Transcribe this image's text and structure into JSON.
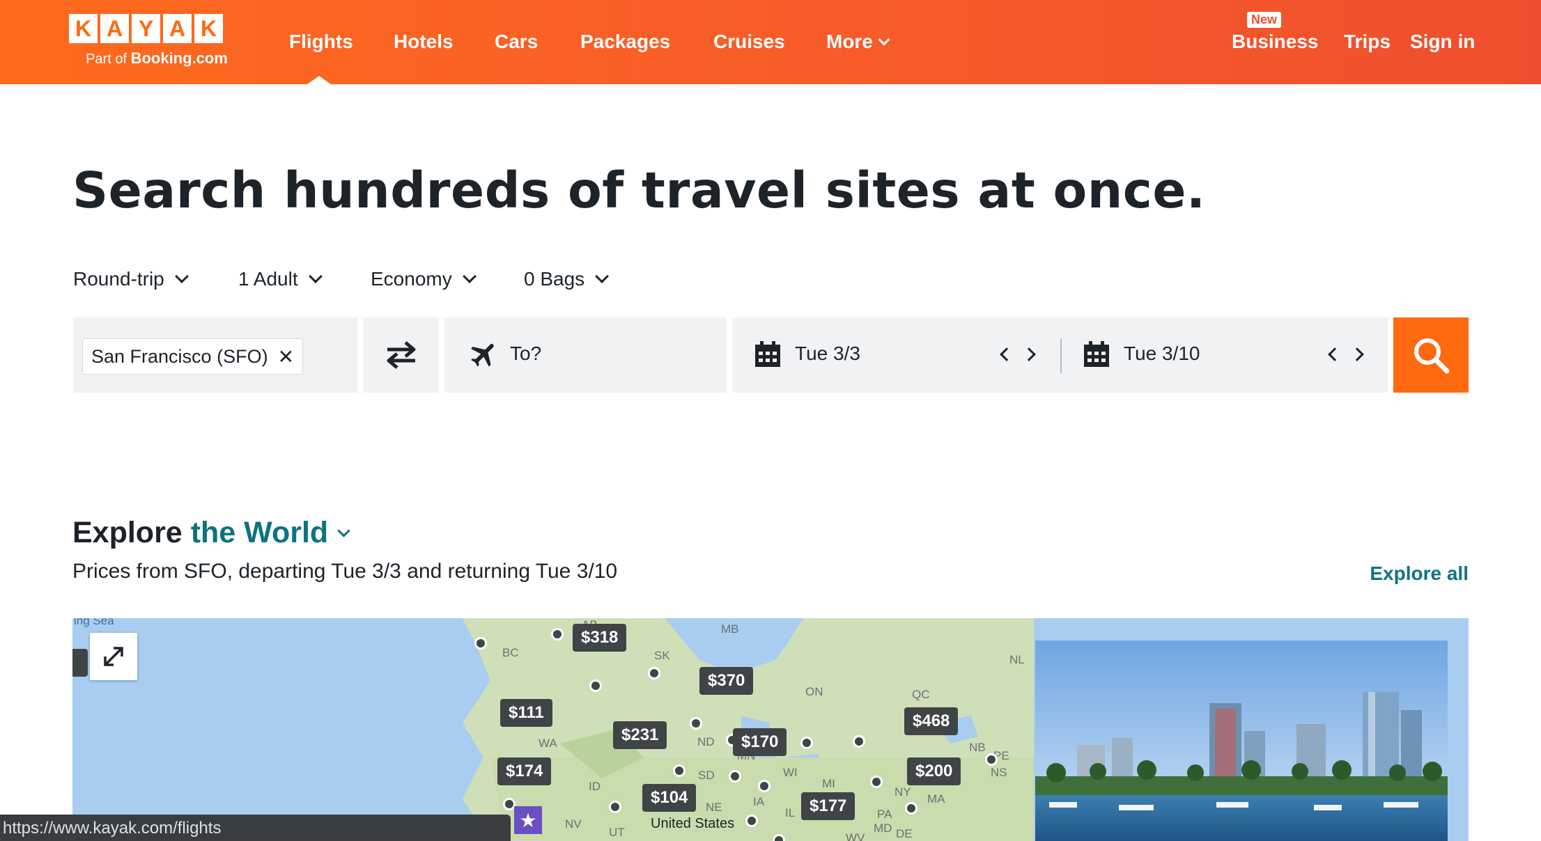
{
  "logo": {
    "letters": [
      "K",
      "A",
      "Y",
      "A",
      "K"
    ],
    "sub_prefix": "Part of",
    "sub_brand": "Booking.com"
  },
  "nav": {
    "items": [
      {
        "label": "Flights"
      },
      {
        "label": "Hotels"
      },
      {
        "label": "Cars"
      },
      {
        "label": "Packages"
      },
      {
        "label": "Cruises"
      },
      {
        "label": "More"
      }
    ],
    "right": {
      "badge": "New",
      "business": "Business",
      "trips": "Trips",
      "signin": "Sign in"
    }
  },
  "headline": "Search hundreds of travel sites at once.",
  "options": {
    "trip": "Round-trip",
    "travelers": "1 Adult",
    "cabin": "Economy",
    "bags": "0 Bags"
  },
  "search": {
    "origin_chip": "San Francisco (SFO)",
    "destination_placeholder": "To?",
    "depart": "Tue 3/3",
    "return": "Tue 3/10"
  },
  "explore": {
    "title_prefix": "Explore",
    "title_accent": "the World",
    "subtitle": "Prices from SFO, departing Tue 3/3 and returning Tue 3/10",
    "explore_all": "Explore all"
  },
  "map": {
    "prices": [
      "$318",
      "$370",
      "$111",
      "$231",
      "$170",
      "$468",
      "$174",
      "$200",
      "$104",
      "$177"
    ],
    "labels": [
      "BC",
      "AB",
      "SK",
      "MB",
      "ON",
      "QC",
      "NL",
      "NB",
      "PE",
      "NS",
      "WA",
      "ND",
      "SD",
      "MN",
      "WI",
      "MI",
      "IA",
      "IL",
      "NE",
      "NY",
      "MA",
      "PA",
      "MD",
      "DE",
      "ID",
      "NV",
      "UT",
      "WV",
      "United States"
    ],
    "partial_text": "ing Sea"
  },
  "status_url": "https://www.kayak.com/flights",
  "colors": {
    "brand_orange": "#ff690f",
    "accent_teal": "#0d7380",
    "price_pill": "#3f4447"
  }
}
